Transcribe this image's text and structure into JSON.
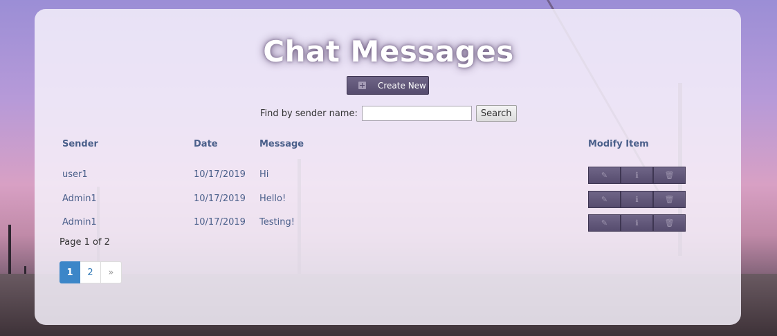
{
  "page": {
    "title": "Chat Messages",
    "create_label": "Create New",
    "search": {
      "label": "Find by sender name:",
      "value": "",
      "button_label": "Search"
    }
  },
  "table": {
    "headers": {
      "sender": "Sender",
      "date": "Date",
      "message": "Message",
      "modify": "Modify Item"
    },
    "rows": [
      {
        "sender": "user1",
        "date": "10/17/2019",
        "message": "Hi"
      },
      {
        "sender": "Admin1",
        "date": "10/17/2019",
        "message": "Hello!"
      },
      {
        "sender": "Admin1",
        "date": "10/17/2019",
        "message": "Testing!"
      }
    ],
    "row_actions": [
      "pencil-icon",
      "info-icon",
      "trash-icon"
    ]
  },
  "pagination": {
    "summary": "Page 1 of 2",
    "pages": [
      "1",
      "2"
    ],
    "next": "»",
    "current": 1
  },
  "colors": {
    "accent_button": "#564c6e",
    "header_text": "#4a5f8a",
    "active_page": "#3c86c8"
  }
}
